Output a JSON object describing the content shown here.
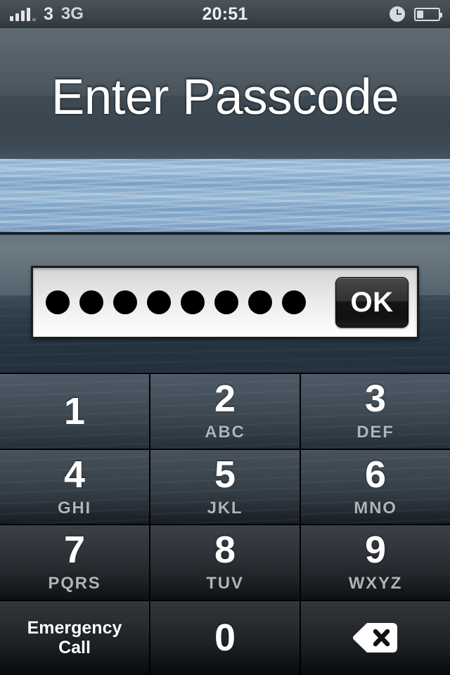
{
  "status_bar": {
    "signal_icon": "signal-bars-icon",
    "signal_strength": 4,
    "signal_total": 5,
    "carrier": "3",
    "network_type": "3G",
    "time": "20:51",
    "alarm_icon": "alarm-clock-icon",
    "battery_icon": "battery-icon",
    "battery_level_percent": 30
  },
  "lock_screen": {
    "title": "Enter Passcode"
  },
  "passcode_field": {
    "name": "passcode-input",
    "entered_digits": 8,
    "masked_value": "●●●●●●●●",
    "ok_label": "OK"
  },
  "keypad": {
    "keys": [
      {
        "digit": "1",
        "letters": ""
      },
      {
        "digit": "2",
        "letters": "ABC"
      },
      {
        "digit": "3",
        "letters": "DEF"
      },
      {
        "digit": "4",
        "letters": "GHI"
      },
      {
        "digit": "5",
        "letters": "JKL"
      },
      {
        "digit": "6",
        "letters": "MNO"
      },
      {
        "digit": "7",
        "letters": "PQRS"
      },
      {
        "digit": "8",
        "letters": "TUV"
      },
      {
        "digit": "9",
        "letters": "WXYZ"
      },
      {
        "digit": "0",
        "letters": ""
      }
    ],
    "emergency_line1": "Emergency",
    "emergency_line2": "Call",
    "delete_icon": "delete-backspace-icon"
  },
  "colors": {
    "key_text": "#ffffff",
    "key_letters": "#aeb4b9",
    "status_text": "#e8eaec",
    "field_background": "#f0f0f0",
    "dot_color": "#000000",
    "ok_button_background": "#1a1a1a"
  }
}
